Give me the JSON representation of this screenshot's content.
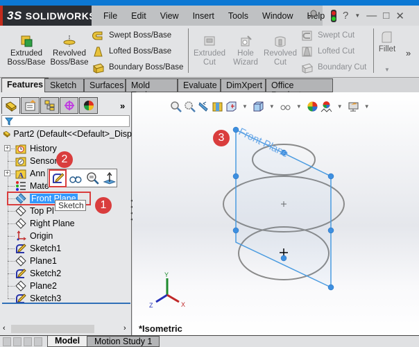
{
  "app": {
    "brand": "SOLIDWORKS",
    "brand_mark": "3S"
  },
  "menu": [
    "File",
    "Edit",
    "View",
    "Insert",
    "Tools",
    "Window",
    "Help"
  ],
  "title_controls": {
    "help_icon": "?",
    "minimize": "—",
    "restore": "□",
    "close": "✕"
  },
  "ribbon": {
    "extruded_boss": "Extruded Boss/Base",
    "extruded_boss_l1": "Extruded",
    "extruded_boss_l2": "Boss/Base",
    "revolved_boss_l1": "Revolved",
    "revolved_boss_l2": "Boss/Base",
    "swept_boss": "Swept Boss/Base",
    "lofted_boss": "Lofted Boss/Base",
    "boundary_boss": "Boundary Boss/Base",
    "extruded_cut_l1": "Extruded",
    "extruded_cut_l2": "Cut",
    "hole_wizard_l1": "Hole",
    "hole_wizard_l2": "Wizard",
    "revolved_cut_l1": "Revolved",
    "revolved_cut_l2": "Cut",
    "swept_cut": "Swept Cut",
    "lofted_cut": "Lofted Cut",
    "boundary_cut": "Boundary Cut",
    "fillet": "Fillet",
    "more": "»"
  },
  "command_tabs": [
    "Features",
    "Sketch",
    "Surfaces",
    "Mold Tools",
    "Evaluate",
    "DimXpert",
    "Office Products"
  ],
  "active_command_tab": "Features",
  "feature_manager": {
    "more": "»",
    "root": "Part2  (Default<<Default>_Disp",
    "items": [
      {
        "label": "History",
        "icon": "history-icon",
        "expandable": true
      },
      {
        "label": "Sensors",
        "icon": "sensors-icon",
        "expandable": false
      },
      {
        "label": "Ann",
        "icon": "annotations-icon",
        "expandable": true
      },
      {
        "label": "Mate",
        "icon": "material-icon",
        "expandable": false
      },
      {
        "label": "Front Plane",
        "icon": "plane-icon",
        "expandable": false,
        "selected": true
      },
      {
        "label": "Top Pl",
        "icon": "plane-icon",
        "expandable": false
      },
      {
        "label": "Right Plane",
        "icon": "plane-icon",
        "expandable": false
      },
      {
        "label": "Origin",
        "icon": "origin-icon",
        "expandable": false
      },
      {
        "label": "Sketch1",
        "icon": "sketch-icon",
        "expandable": false
      },
      {
        "label": "Plane1",
        "icon": "plane-icon",
        "expandable": false
      },
      {
        "label": "Sketch2",
        "icon": "sketch-icon",
        "expandable": false
      },
      {
        "label": "Plane2",
        "icon": "plane-icon",
        "expandable": false
      },
      {
        "label": "Sketch3",
        "icon": "sketch-icon",
        "expandable": false
      }
    ]
  },
  "context_toolbar": {
    "tooltip": "Sketch",
    "items": [
      "sketch-icon",
      "view-icon",
      "zoom-to-selection-icon",
      "normal-to-icon"
    ]
  },
  "callouts": [
    "1",
    "2",
    "3"
  ],
  "viewport": {
    "view_label": "*Isometric",
    "plane_label": "Front Plane",
    "triad": {
      "x": "X",
      "y": "Y",
      "z": "Z"
    }
  },
  "bottom_tabs": [
    "Model",
    "Motion Study 1"
  ],
  "active_bottom_tab": "Model",
  "colors": {
    "accent": "#0c78d3",
    "callout": "#d93d3d",
    "selection": "#3399ff",
    "plane": "#4a9be0"
  }
}
